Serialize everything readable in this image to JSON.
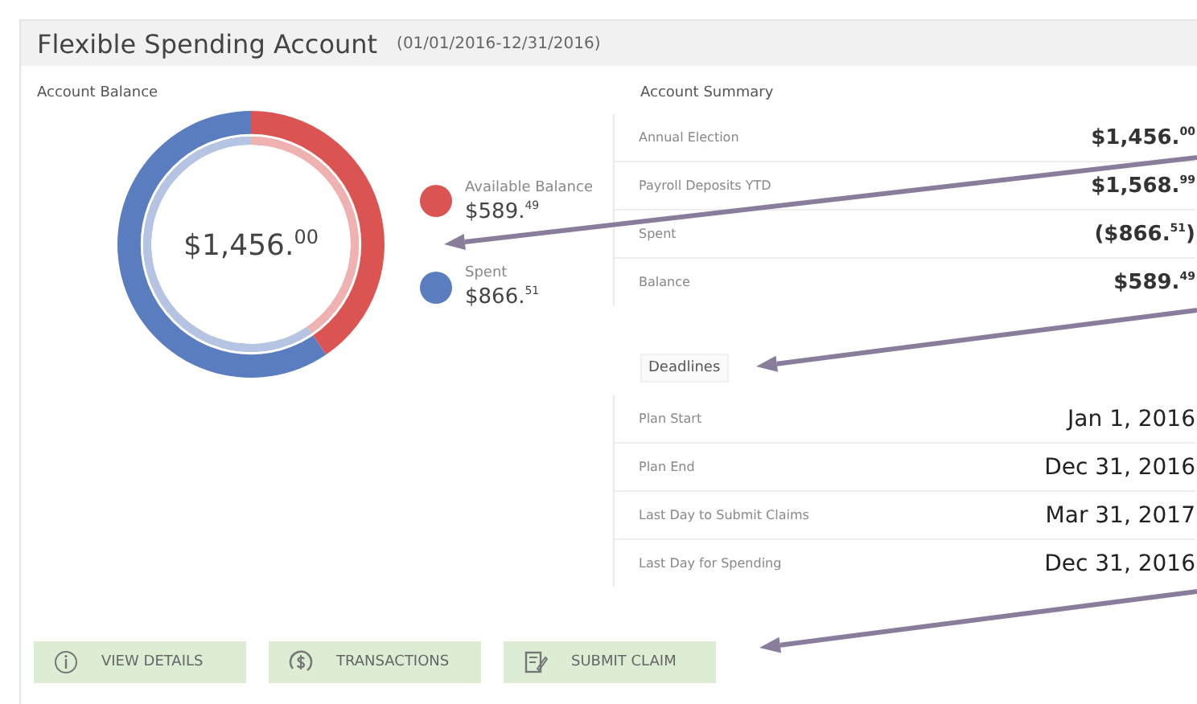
{
  "header": {
    "title": "Flexible Spending Account",
    "period": "(01/01/2016-12/31/2016)"
  },
  "account_balance": {
    "total": "$1,456.$^{00}$",
    "chart_data": {
      "type": "donut",
      "categories": [
        "Available Balance",
        "Spent"
      ],
      "colors": [
        "#dc5452",
        "#5a7dbf"
      ],
      "series": [
        {
          "name": "Account Balance",
          "values": [
            40.49,
            59.51
          ]
        }
      ],
      "value_labels": [
        "$589.$^{49}$",
        "$866.$^{51}$"
      ]
    }
  },
  "account_summary": {
    "title": "Account Summary",
    "rows": [
      {
        "label": "Annual Election",
        "value": "$1,456.$^{00}$"
      },
      {
        "label": "Payroll Deposits YTD",
        "value": "$1,568.$^{99}$"
      },
      {
        "label": "Spent",
        "value": "($866.$^{51}$)"
      },
      {
        "label": "Balance",
        "value": "$589.$^{49}$"
      }
    ]
  },
  "deadlines": {
    "title": "Deadlines",
    "rows": [
      {
        "label": "Plan Start",
        "value": "Jan 1, 2016"
      },
      {
        "label": "Plan End",
        "value": "Dec 31, 2016"
      },
      {
        "label": "Last Day to Submit Claims",
        "value": "Mar 31, 2017"
      },
      {
        "label": "Last Day for Spending",
        "value": "Dec 31, 2016"
      }
    ]
  },
  "buttons": [
    {
      "label": "VIEW DETAILS",
      "kind": "info"
    },
    {
      "label": "TRANSACTIONS",
      "kind": "dollar"
    },
    {
      "label": "SUBMIT CLAIM",
      "kind": "claim"
    }
  ]
}
